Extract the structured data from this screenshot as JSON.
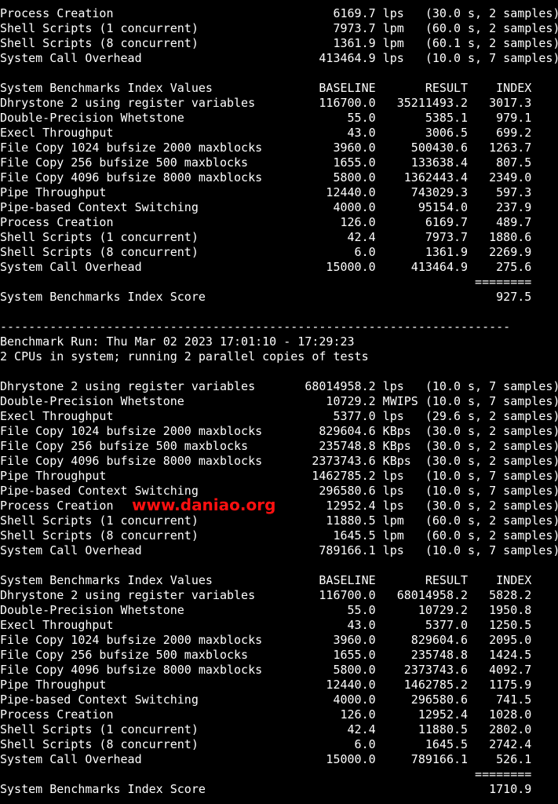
{
  "terminal": {
    "lines": [
      "Process Creation                               6169.7 lps   (30.0 s, 2 samples)",
      "Shell Scripts (1 concurrent)                   7973.7 lpm   (60.0 s, 2 samples)",
      "Shell Scripts (8 concurrent)                   1361.9 lpm   (60.1 s, 2 samples)",
      "System Call Overhead                         413464.9 lps   (10.0 s, 7 samples)",
      "",
      "System Benchmarks Index Values               BASELINE       RESULT    INDEX",
      "Dhrystone 2 using register variables         116700.0   35211493.2   3017.3",
      "Double-Precision Whetstone                       55.0       5385.1    979.1",
      "Execl Throughput                                 43.0       3006.5    699.2",
      "File Copy 1024 bufsize 2000 maxblocks          3960.0     500430.6   1263.7",
      "File Copy 256 bufsize 500 maxblocks            1655.0     133638.4    807.5",
      "File Copy 4096 bufsize 8000 maxblocks          5800.0    1362443.4   2349.0",
      "Pipe Throughput                               12440.0     743029.3    597.3",
      "Pipe-based Context Switching                   4000.0      95154.0    237.9",
      "Process Creation                                126.0       6169.7    489.7",
      "Shell Scripts (1 concurrent)                     42.4       7973.7   1880.6",
      "Shell Scripts (8 concurrent)                      6.0       1361.9   2269.9",
      "System Call Overhead                          15000.0     413464.9    275.6",
      "                                                                   ========",
      "System Benchmarks Index Score                                         927.5",
      "",
      "------------------------------------------------------------------------",
      "Benchmark Run: Thu Mar 02 2023 17:01:10 - 17:29:23",
      "2 CPUs in system; running 2 parallel copies of tests",
      "",
      "Dhrystone 2 using register variables       68014958.2 lps   (10.0 s, 7 samples)",
      "Double-Precision Whetstone                    10729.2 MWIPS (10.0 s, 7 samples)",
      "Execl Throughput                               5377.0 lps   (29.6 s, 2 samples)",
      "File Copy 1024 bufsize 2000 maxblocks        829604.6 KBps  (30.0 s, 2 samples)",
      "File Copy 256 bufsize 500 maxblocks          235748.8 KBps  (30.0 s, 2 samples)",
      "File Copy 4096 bufsize 8000 maxblocks       2373743.6 KBps  (30.0 s, 2 samples)",
      "Pipe Throughput                             1462785.2 lps   (10.0 s, 7 samples)",
      "Pipe-based Context Switching                 296580.6 lps   (10.0 s, 7 samples)",
      "Process Creation                              12952.4 lps   (30.0 s, 2 samples)",
      "Shell Scripts (1 concurrent)                  11880.5 lpm   (60.0 s, 2 samples)",
      "Shell Scripts (8 concurrent)                   1645.5 lpm   (60.0 s, 2 samples)",
      "System Call Overhead                         789166.1 lps   (10.0 s, 7 samples)",
      "",
      "System Benchmarks Index Values               BASELINE       RESULT    INDEX",
      "Dhrystone 2 using register variables         116700.0   68014958.2   5828.2",
      "Double-Precision Whetstone                       55.0      10729.2   1950.8",
      "Execl Throughput                                 43.0       5377.0   1250.5",
      "File Copy 1024 bufsize 2000 maxblocks          3960.0     829604.6   2095.0",
      "File Copy 256 bufsize 500 maxblocks            1655.0     235748.8   1424.5",
      "File Copy 4096 bufsize 8000 maxblocks          5800.0    2373743.6   4092.7",
      "Pipe Throughput                               12440.0    1462785.2   1175.9",
      "Pipe-based Context Switching                   4000.0     296580.6    741.5",
      "Process Creation                                126.0      12952.4   1028.0",
      "Shell Scripts (1 concurrent)                     42.4      11880.5   2802.0",
      "Shell Scripts (8 concurrent)                      6.0       1645.5   2742.4",
      "System Call Overhead                          15000.0     789166.1    526.1",
      "                                                                   ========",
      "System Benchmarks Index Score                                        1710.9"
    ]
  },
  "watermark": {
    "text": "www.daniao.org",
    "color": "#ff1010"
  },
  "colors": {
    "background": "#000000",
    "foreground": "#ffffff"
  }
}
